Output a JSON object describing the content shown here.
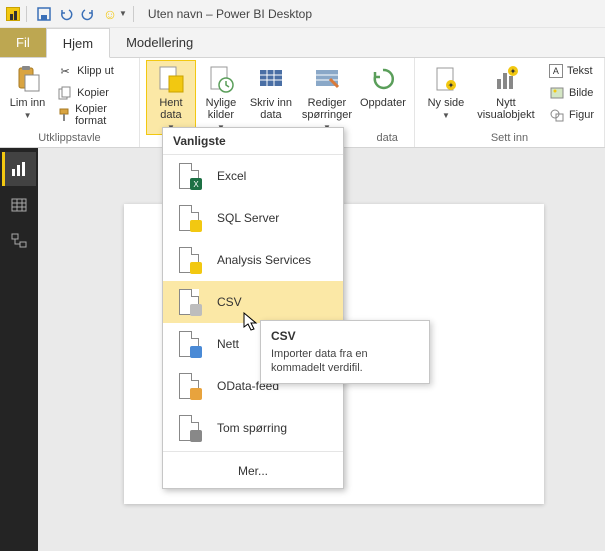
{
  "titlebar": {
    "title": "Uten navn – Power BI Desktop"
  },
  "tabs": {
    "file": "Fil",
    "home": "Hjem",
    "modeling": "Modellering"
  },
  "ribbon": {
    "clipboard": {
      "paste": "Lim inn",
      "cut": "Klipp ut",
      "copy": "Kopier",
      "format_painter": "Kopier format",
      "group_label": "Utklippstavle"
    },
    "data": {
      "get_data": "Hent data",
      "recent": "Nylige kilder",
      "enter": "Skriv inn data",
      "edit_queries": "Rediger spørringer",
      "refresh": "Oppdater",
      "group_label": "data"
    },
    "insert": {
      "new_page": "Ny side",
      "new_visual": "Nytt visualobjekt",
      "text": "Tekst",
      "image": "Bilde",
      "shapes": "Figur",
      "group_label": "Sett inn"
    }
  },
  "dropdown": {
    "header": "Vanligste",
    "items": [
      {
        "label": "Excel",
        "badge_bg": "#1d7044",
        "badge_text": "X"
      },
      {
        "label": "SQL Server",
        "badge_bg": "#f2c811",
        "badge_text": ""
      },
      {
        "label": "Analysis Services",
        "badge_bg": "#f2c811",
        "badge_text": ""
      },
      {
        "label": "CSV",
        "badge_bg": "#bdbdbd",
        "badge_text": ""
      },
      {
        "label": "Nett",
        "badge_bg": "#4a8ad6",
        "badge_text": ""
      },
      {
        "label": "OData-feed",
        "badge_bg": "#e8a33d",
        "badge_text": ""
      },
      {
        "label": "Tom spørring",
        "badge_bg": "#888",
        "badge_text": ""
      }
    ],
    "more": "Mer..."
  },
  "tooltip": {
    "title": "CSV",
    "body": "Importer data fra en kommadelt verdifil."
  }
}
